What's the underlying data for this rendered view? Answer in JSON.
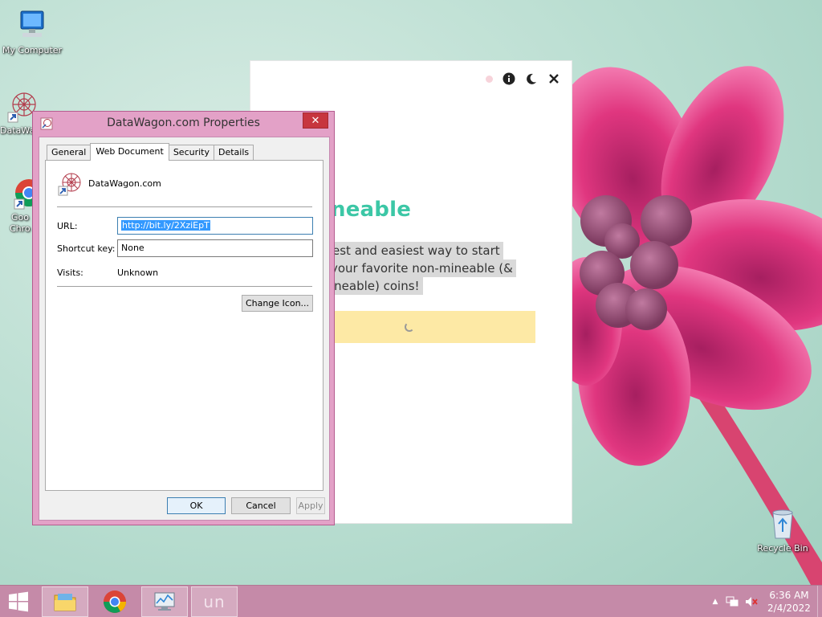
{
  "desktop": {
    "icons": [
      {
        "label": "My Computer"
      },
      {
        "label": "DataWa"
      },
      {
        "label": "Goo"
      },
      {
        "label": "Chro"
      },
      {
        "label": "Recycle Bin"
      }
    ]
  },
  "app_window": {
    "title": "neable",
    "desc_lines": [
      "est and easiest way to start",
      "your favorite non-mineable (&",
      "ineable) coins!"
    ],
    "controls": [
      "info-icon",
      "moon-icon",
      "close-icon"
    ]
  },
  "dialog": {
    "title": "DataWagon.com Properties",
    "tabs": [
      "General",
      "Web Document",
      "Security",
      "Details"
    ],
    "active_tab": "Web Document",
    "shortcut_name": "DataWagon.com",
    "url_label": "URL:",
    "url_value": "http://bit.ly/2XziEpT",
    "shortcut_key_label": "Shortcut key:",
    "shortcut_key_value": "None",
    "visits_label": "Visits:",
    "visits_value": "Unknown",
    "change_icon_label": "Change Icon...",
    "ok_label": "OK",
    "cancel_label": "Cancel",
    "apply_label": "Apply"
  },
  "taskbar": {
    "apps": [
      "start-button",
      "file-explorer",
      "chrome",
      "performance-monitor",
      "unmineable-app"
    ],
    "unmineable_label": "un",
    "clock_time": "6:36 AM",
    "clock_date": "2/4/2022"
  },
  "colors": {
    "accent_green": "#3cc7a6",
    "taskbar": "#c58aa8",
    "dialog_frame": "#e3a1c7",
    "close_red": "#c7363f",
    "loading_bar": "#fde9a5"
  }
}
